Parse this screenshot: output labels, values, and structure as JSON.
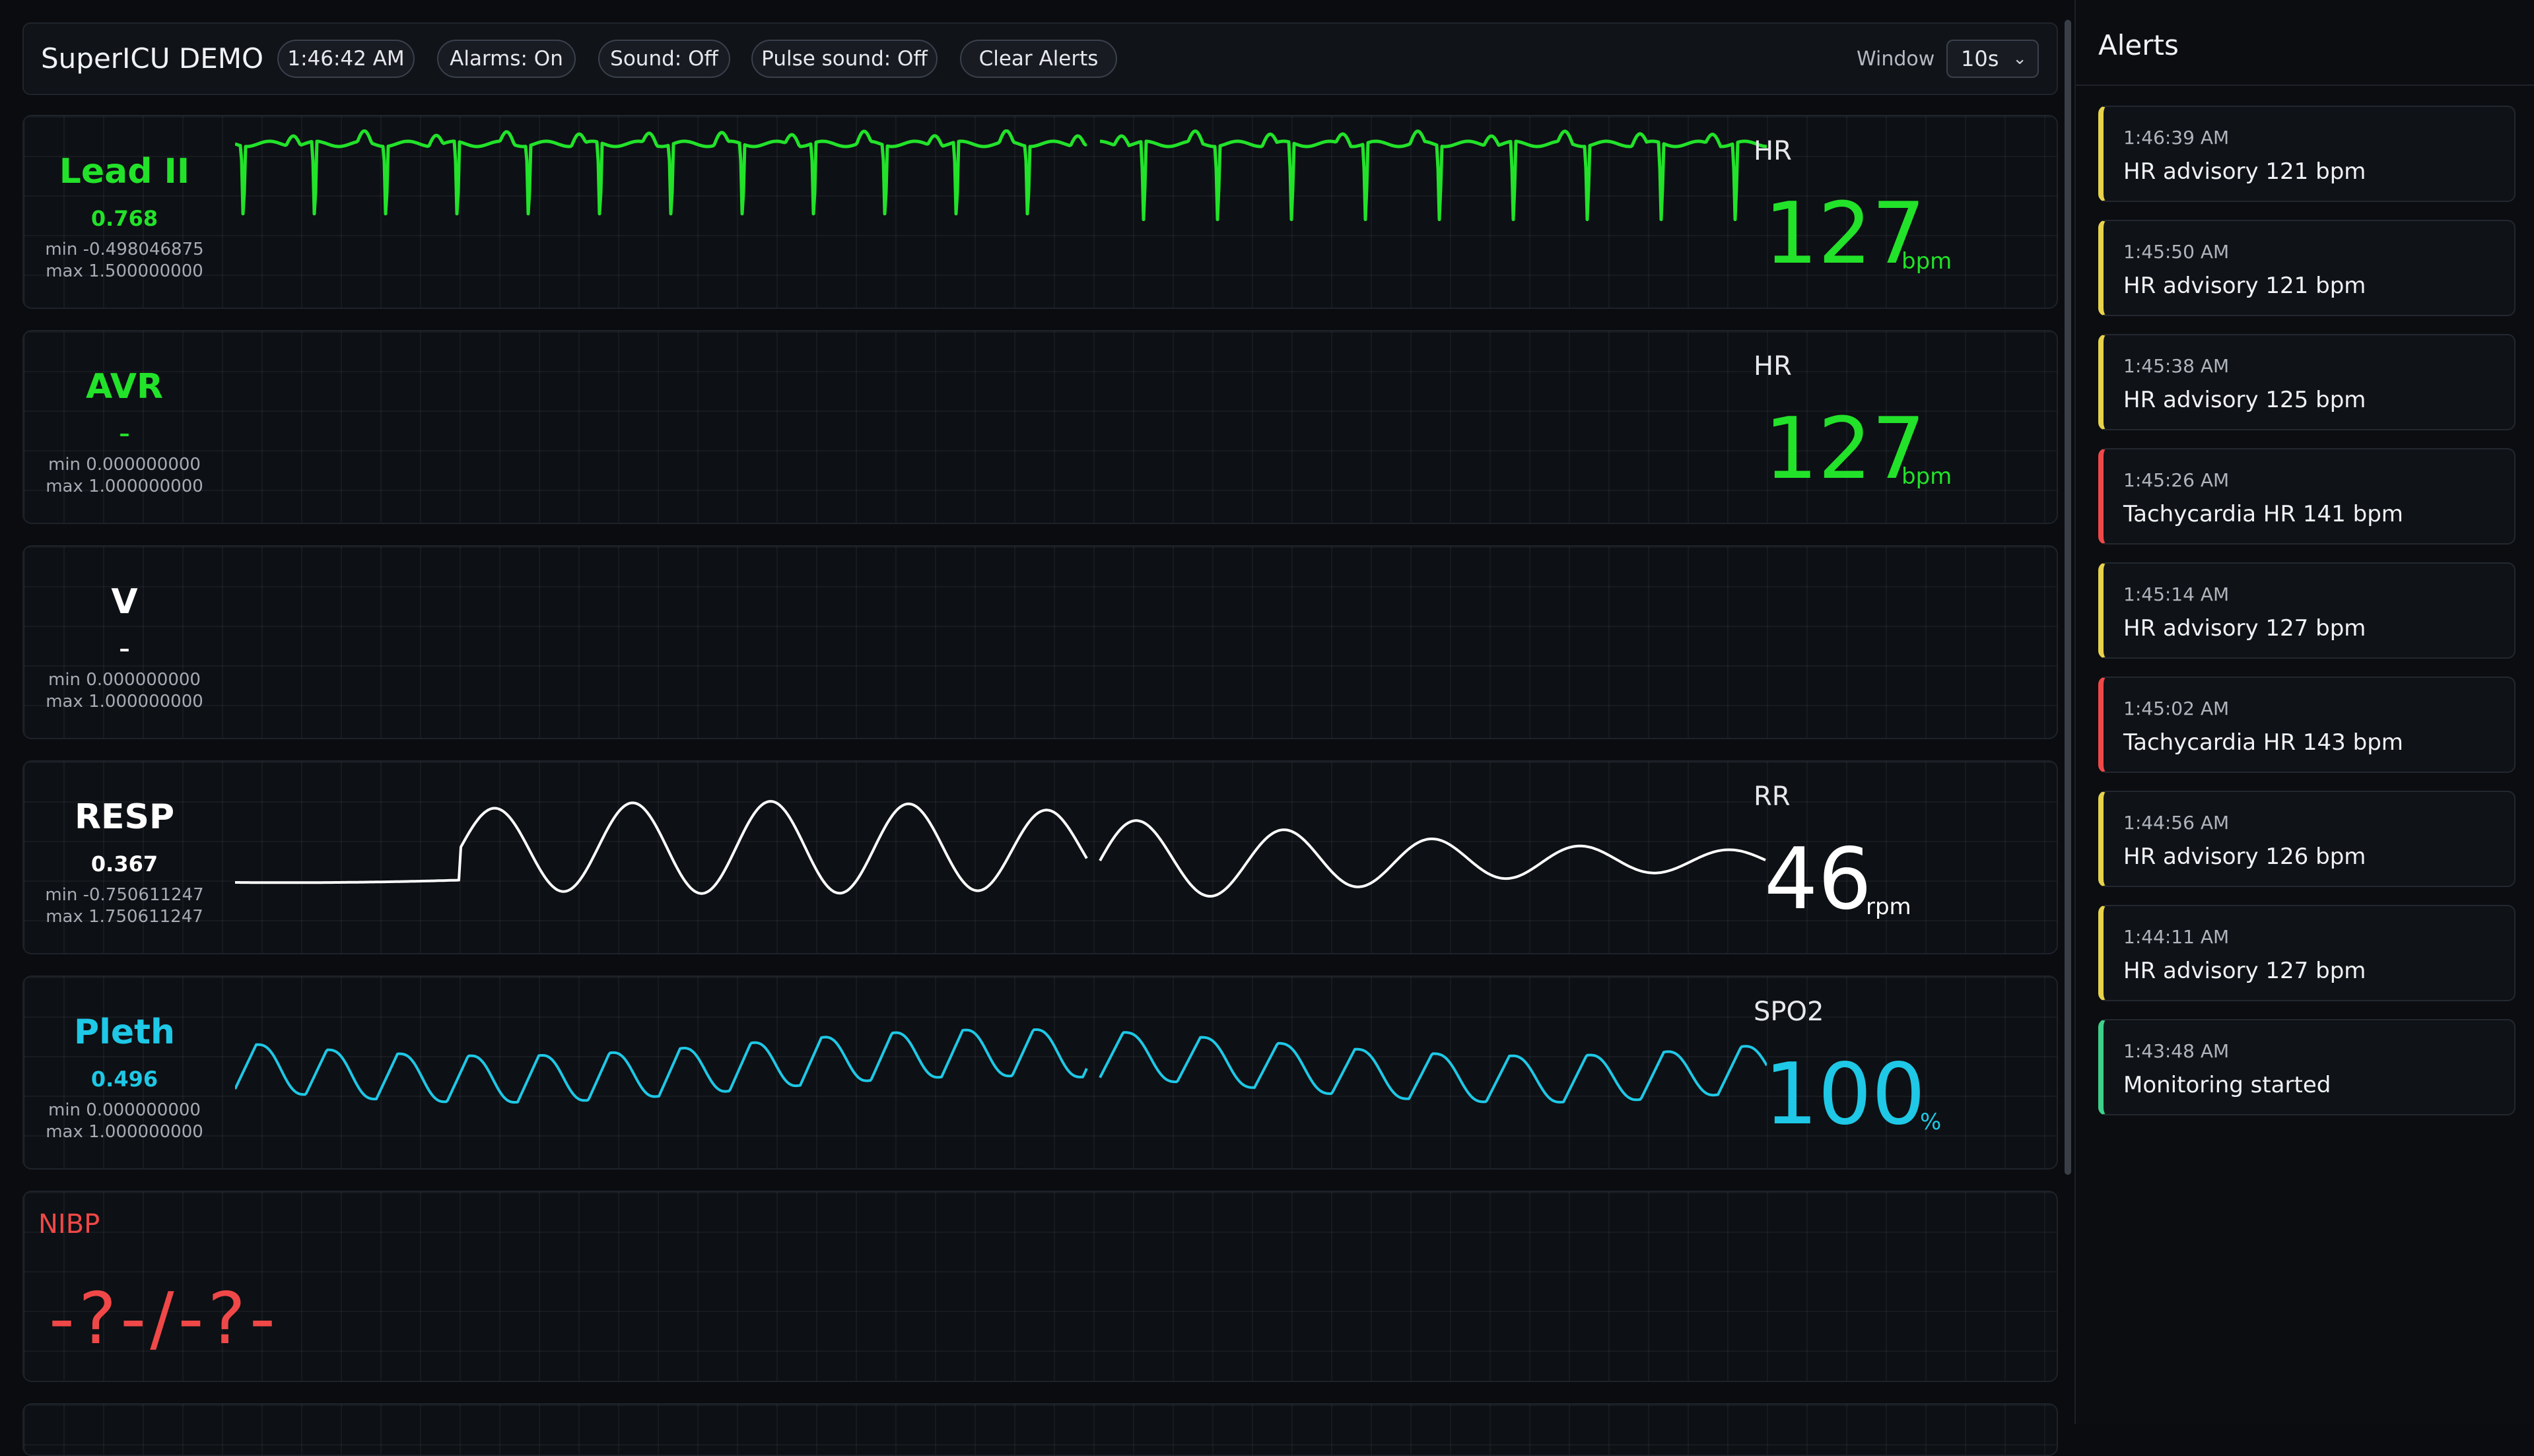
{
  "header": {
    "title": "SuperICU DEMO",
    "clock": "1:46:42 AM",
    "alarms": "Alarms: On",
    "sound": "Sound: Off",
    "pulse_sound": "Pulse sound: Off",
    "clear_alerts": "Clear Alerts",
    "window_label": "Window",
    "window_value": "10s"
  },
  "panels": [
    {
      "name": "Lead II",
      "value": "0.768",
      "min": "min -0.498046875",
      "max": "max 1.500000000",
      "color": "#22e22a",
      "vital": {
        "label": "HR",
        "value": "127",
        "unit": "bpm",
        "color": "#22e22a"
      }
    },
    {
      "name": "AVR",
      "value": "–",
      "min": "min 0.000000000",
      "max": "max 1.000000000",
      "color": "#22e22a",
      "vital": {
        "label": "HR",
        "value": "127",
        "unit": "bpm",
        "color": "#22e22a"
      }
    },
    {
      "name": "V",
      "value": "–",
      "min": "min 0.000000000",
      "max": "max 1.000000000",
      "color": "#ffffff"
    },
    {
      "name": "RESP",
      "value": "0.367",
      "min": "min -0.750611247",
      "max": "max 1.750611247",
      "color": "#ffffff",
      "vital": {
        "label": "RR",
        "value": "46",
        "unit": "rpm",
        "color": "#ffffff"
      }
    },
    {
      "name": "Pleth",
      "value": "0.496",
      "min": "min 0.000000000",
      "max": "max 1.000000000",
      "color": "#1ec8e6",
      "vital": {
        "label": "SPO2",
        "value": "100",
        "unit": "%",
        "color": "#1ec8e6"
      }
    }
  ],
  "nibp": {
    "label": "NIBP",
    "value": "-?-/-?-",
    "color": "#f04848"
  },
  "alerts": {
    "title": "Alerts",
    "items": [
      {
        "time": "1:46:39 AM",
        "message": "HR advisory 121 bpm",
        "severity": "advisory"
      },
      {
        "time": "1:45:50 AM",
        "message": "HR advisory 121 bpm",
        "severity": "advisory"
      },
      {
        "time": "1:45:38 AM",
        "message": "HR advisory 125 bpm",
        "severity": "advisory"
      },
      {
        "time": "1:45:26 AM",
        "message": "Tachycardia HR 141 bpm",
        "severity": "critical"
      },
      {
        "time": "1:45:14 AM",
        "message": "HR advisory 127 bpm",
        "severity": "advisory"
      },
      {
        "time": "1:45:02 AM",
        "message": "Tachycardia HR 143 bpm",
        "severity": "critical"
      },
      {
        "time": "1:44:56 AM",
        "message": "HR advisory 126 bpm",
        "severity": "advisory"
      },
      {
        "time": "1:44:11 AM",
        "message": "HR advisory 127 bpm",
        "severity": "advisory"
      },
      {
        "time": "1:43:48 AM",
        "message": "Monitoring started",
        "severity": "info"
      }
    ]
  },
  "colors": {
    "ecg": "#22e22a",
    "pleth": "#1ec8e6",
    "resp": "#ffffff",
    "alarm": "#f04848",
    "advisory": "#e8d24a",
    "ok": "#3ed08a"
  }
}
